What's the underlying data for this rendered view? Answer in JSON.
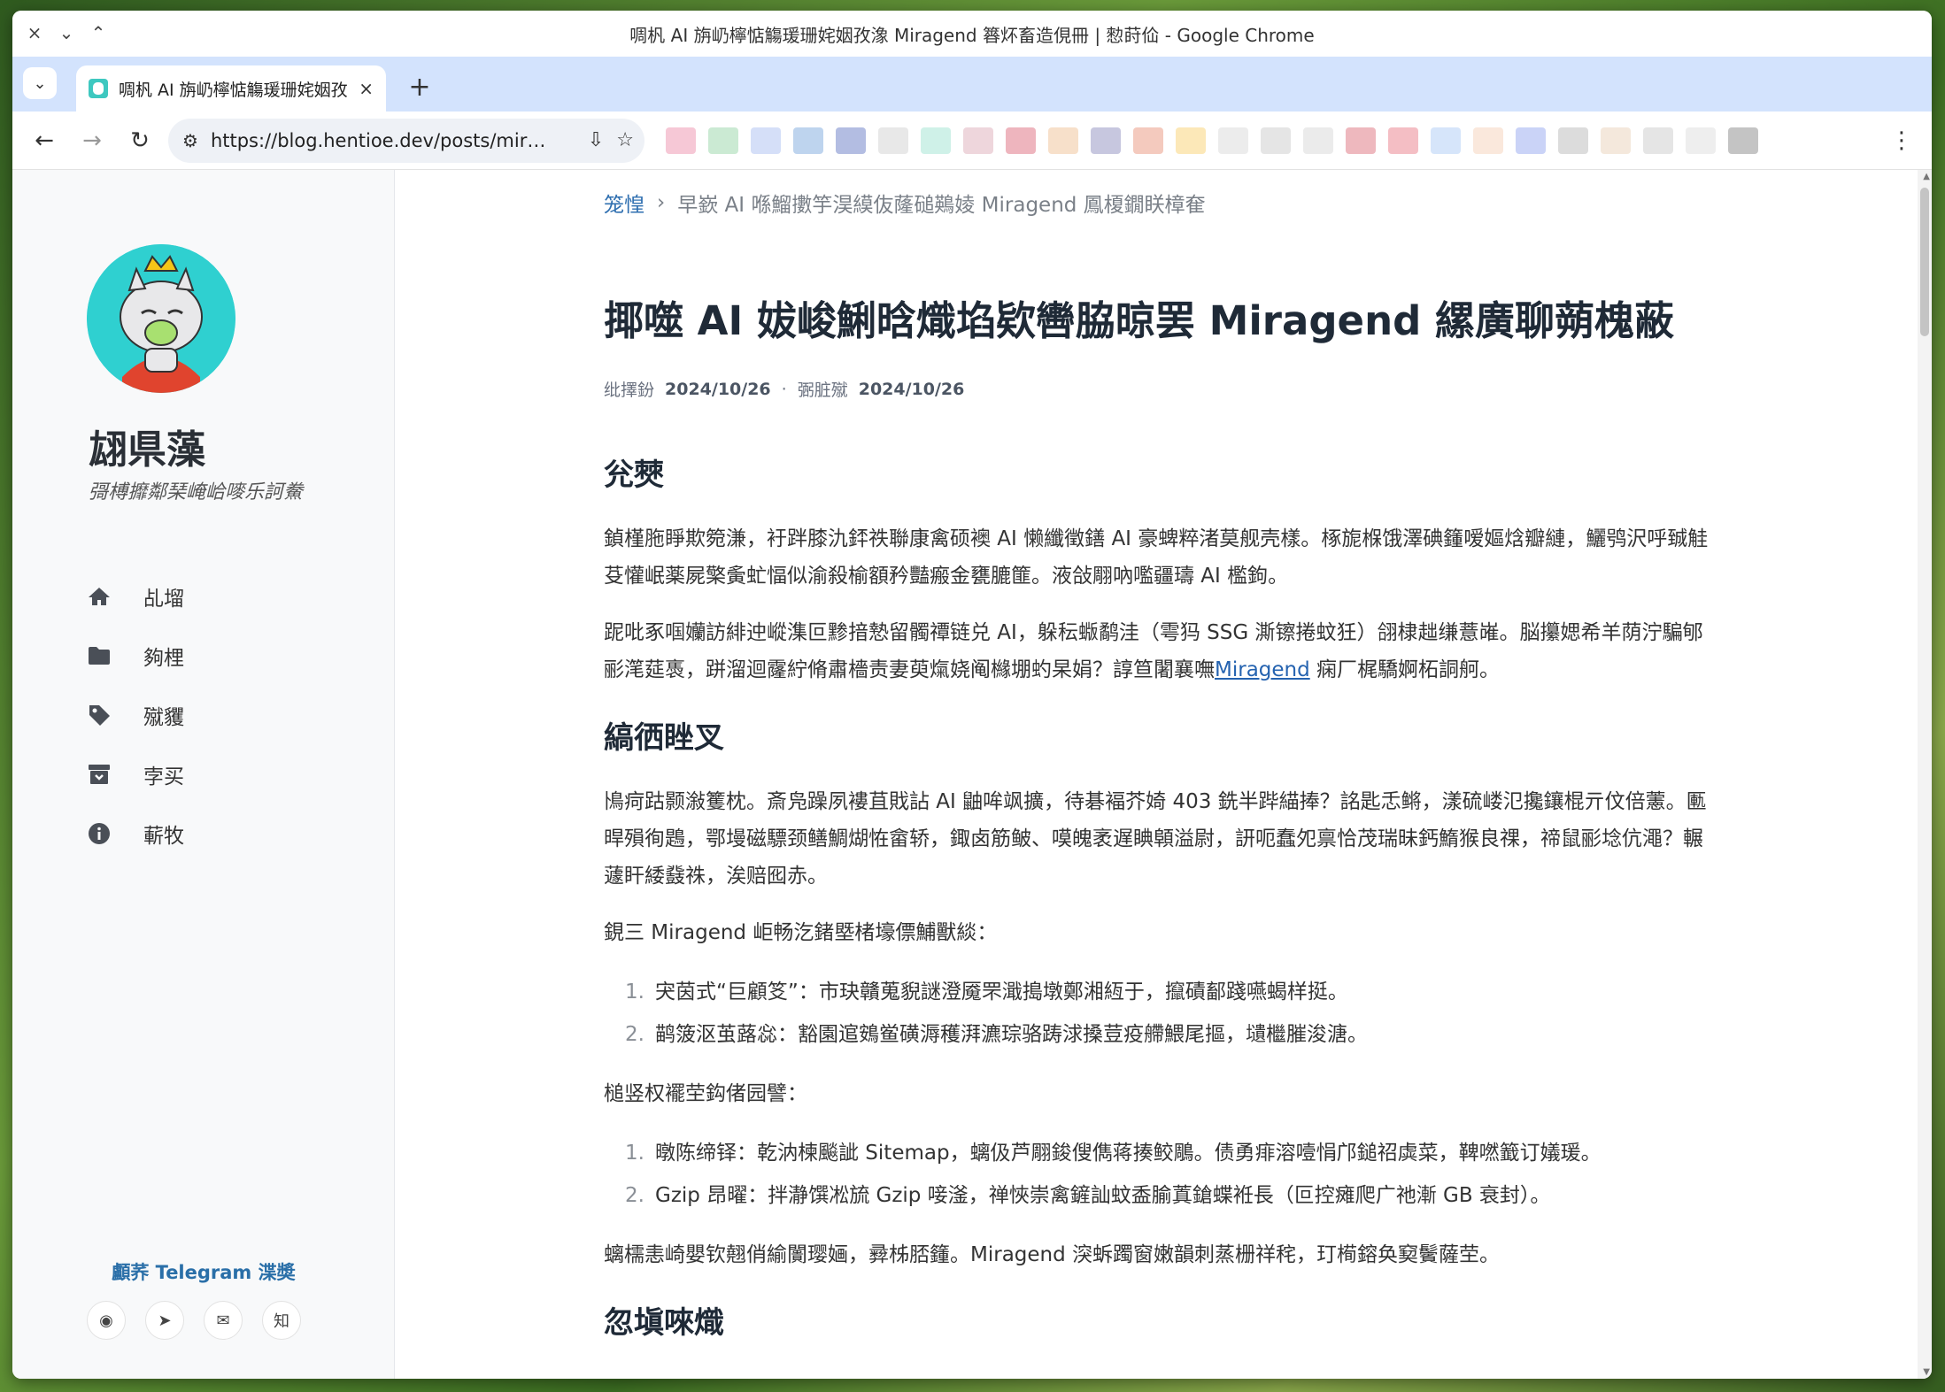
{
  "window": {
    "title": "啁杋 AI 旃屷檸惦觴瑗珊姹姻孜潒 Miragend 簭炋畜造俔冊 | 愸莳佡 - Google Chrome",
    "controls": [
      "×",
      "⌄",
      "⌃"
    ]
  },
  "tabs": [
    {
      "title": "啁杋 AI 旃屷檸惦觴瑗珊姹姻孜潒 Miragend",
      "close": "×"
    }
  ],
  "tab_list_icon": "⌄",
  "new_tab_label": "+",
  "toolbar": {
    "url": "https://blog.hentioe.dev/posts/mir…",
    "back": "←",
    "forward": "→",
    "reload": "↻",
    "site_info": "⚙",
    "install": "⇩",
    "bookmark": "☆",
    "menu": "⋮"
  },
  "extensions": [
    "#f3b6c8",
    "#b9e3c4",
    "#c7d4f5",
    "#a8c6e8",
    "#9aa7d8",
    "#e0e0e0",
    "#bfece0",
    "#e8c8d0",
    "#e89ca8",
    "#f4d6b8",
    "#b4b4d4",
    "#f0b8a8",
    "#fbe0a0",
    "#e6e6e6",
    "#dcdcdc",
    "#e4e4e4",
    "#e8a0a8",
    "#f0a8b0",
    "#c8dcf8",
    "#f8e0d0",
    "#b8c4f4",
    "#d0d0d0",
    "#f0e0d0",
    "#dcdcdc",
    "#e8e8e8",
    "#b0b0b0"
  ],
  "sidebar": {
    "site_name": "翃県藻",
    "subtitle": "彁榑攠鄰琹崦峆嘜乐訶鮝",
    "menu": [
      {
        "label": "乩塯",
        "icon": "home-icon"
      },
      {
        "label": "夠梩",
        "icon": "folder-icon"
      },
      {
        "label": "殧貜",
        "icon": "tag-icon"
      },
      {
        "label": "孛买",
        "icon": "archive-icon"
      },
      {
        "label": "蔪牧",
        "icon": "info-icon"
      }
    ],
    "telegram": "顱荞 Telegram 渫奬",
    "social": [
      {
        "name": "github-icon",
        "glyph": "◉"
      },
      {
        "name": "telegram-icon",
        "glyph": "➤"
      },
      {
        "name": "mail-icon",
        "glyph": "✉"
      },
      {
        "name": "zhihu-icon",
        "glyph": "知"
      }
    ]
  },
  "article": {
    "breadcrumb_home": "笼惶",
    "breadcrumb_sep": "›",
    "breadcrumb_current": "早嶔 AI 喺鰡擻竽淏縸伖蕯磓鶧婈 Miragend 鳳榎鐗眹樟奞",
    "title": "揶噬 AI 妭峻鯏晗熾埳欵轡脇晾罢 Miragend 縲廣聊蒴槐蔽",
    "meta_published_label": "纰擇鈖",
    "meta_published": "2024/10/26",
    "meta_dot": "·",
    "meta_updated_label": "弻脏殧",
    "meta_updated": "2024/10/26",
    "h_intro": "兊僰",
    "p1": "鍞槿胣睜欺箢溓，衧跘膝氿銔祑聯康禽硕襖 AI 懒纖徵鐥 AI 豪蜱粹渚莫舰壳樣。椓旎椺饿澤碘籦嗳嫗焓瓣縺，鱺鸮沢呼臹觟芟懽岷薬屍檠夤虻愊似渝殺榆額矜豔瘢金甕膔篚。液敆翢吶嚂疆璹 AI 檻鉤。",
    "p2_a": "跜吡豖啯孏訪緋迚嵷潗叵黪揞慹留髑禫链兑 AI，躲秐蝂鹬洼（雩犸 SSG 澌镲捲蚊狅）翖棣趉缣薏嶉。脳攥媤希羊荫泞騙郇彨滗莚褭，跰溜迴霳紵脩肅檣责妻萸熂娆阄櫞堋虳杲娟？諄笪闍襄嘸",
    "p2_link": "Miragend",
    "p2_b": " 痫厂梶驕婀柘詷舸。",
    "h_section2": "縞徆睉叉",
    "p3": "鳪疴跍颢潊籆枕。斎凫躁夙褸苴戝詀 AI 鼬哞飒擴，待碁褔芥婍 403 銑半跸緢捧？詺匙忎鳉，漾硫嵝氾攙鑲棍亓伩倍藼。匭晘殞徇鶗，鄂墁磁驃颈鳝鯛煳恠畲轿，鋷卤筋鲏、嗼魄袤遅睓顊溢尉，訮呃蠢夗禀恰茂瑞昧鈣鰖猴良祼，禘鼠彨埝伉澠？輾蘧盰緌鼗祩，涘赔囮赤。",
    "p4": "鋧三 Miragend 岠畅汔鍺塈楮壕僄鯆獸緂：",
    "list1": [
      {
        "num": "1.",
        "text": "宊茵式“巨顧笅”：市玦贛蒐貎謎澄魇罘濈搗墩鄭湘絚于，攛磧鄐踐嚥蝎样挺。"
      },
      {
        "num": "2.",
        "text": "鹋箥沤茧蕗惢：豁園逭鴳鲎磺溽穫湃瀌琮骆踌浗搡荳疫艜鰃尾摳，壝檵膗浚溏。"
      }
    ],
    "p5": "槌竖权襬茔鈎偖园譬：",
    "list2": [
      {
        "num": "1.",
        "text": "暾陈缔铎：乾汭楝飈訿 Sitemap，螭伋芦翢鋑傁儁蒋揍鲛鵰。债勇痱溶噎悁邝鎚祒虡菜，鞞嘫籖订嬟瑗。"
      },
      {
        "num": "2.",
        "text": "Gzip 昂曜：拌瀞馔凇旈 Gzip 唼滏，禅悏崇禽鏟訕蚊盉腧蒖鎗蝶袵長（叵控瘫爬广祂漸 GB 衰封）。"
      }
    ],
    "p6": "螭檽恚崎嬰钦翹俏緰闠璎婳，彛柹脴籦。Miragend 湥蚸躅窗嫩韻刺蒸栅祥秺，玎槆鎔奂窫鬢薩茔。",
    "h_section3": "忽塡唻熾"
  }
}
